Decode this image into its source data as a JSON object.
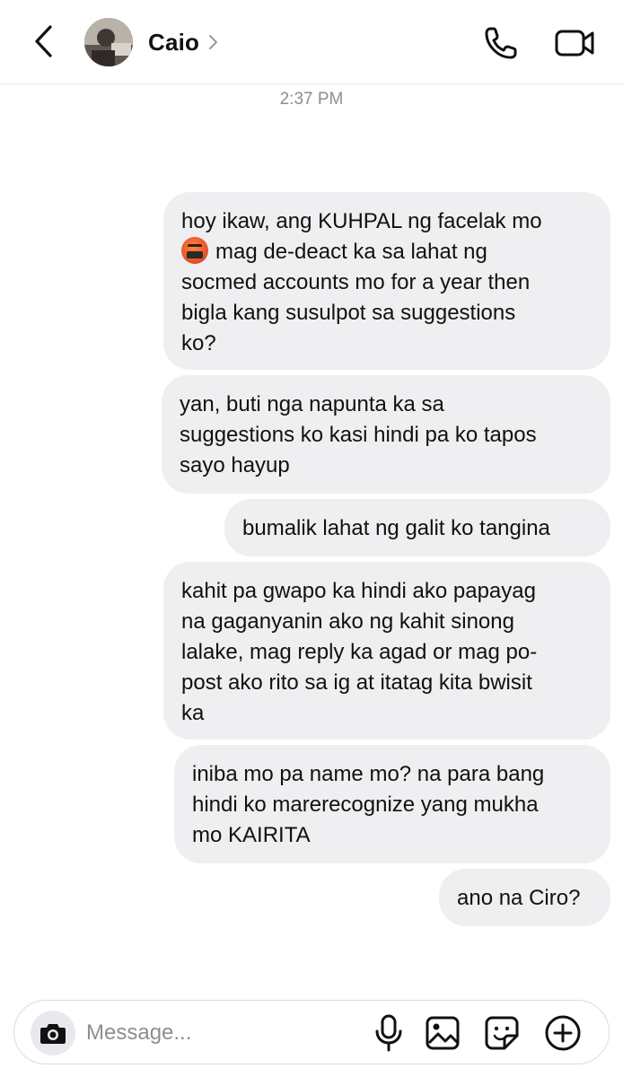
{
  "header": {
    "contact_name": "Caio",
    "avatar_icon": "avatar-photo",
    "back_icon": "chevron-left-icon",
    "profile_chevron_icon": "chevron-right-icon",
    "call_icon": "phone-icon",
    "video_icon": "video-camera-icon"
  },
  "thread": {
    "timestamp": "2:37 PM",
    "messages": [
      {
        "lines": [
          "hoy ikaw, ang KUHPAL ng facelak mo",
          "mag de-deact ka sa lahat ng",
          "socmed accounts mo for a year then",
          "bigla kang susulpot sa suggestions",
          "ko?"
        ],
        "emoji": "face-with-symbols-on-mouth"
      },
      {
        "lines": [
          "yan, buti nga napunta ka sa",
          "suggestions ko kasi hindi pa ko tapos",
          "sayo hayup"
        ]
      },
      {
        "lines": [
          "bumalik lahat ng galit ko tangina"
        ]
      },
      {
        "lines": [
          "kahit pa gwapo ka hindi ako papayag",
          "na gaganyanin ako ng kahit sinong",
          "lalake, mag reply ka agad or mag po-",
          "post ako rito sa ig at itatag kita bwisit",
          "ka"
        ]
      },
      {
        "lines": [
          "iniba mo pa name mo? na para bang",
          "hindi ko marerecognize yang mukha",
          "mo KAIRITA"
        ]
      },
      {
        "lines": [
          "ano na Ciro?"
        ]
      }
    ]
  },
  "composer": {
    "placeholder": "Message...",
    "camera_icon": "camera-icon",
    "mic_icon": "microphone-icon",
    "gallery_icon": "image-gallery-icon",
    "sticker_icon": "sticker-icon",
    "add_icon": "plus-circle-icon"
  },
  "colors": {
    "bubble": "#efeef1",
    "text": "#111111",
    "muted": "#8e8e8e",
    "divider": "#e9e9e9"
  }
}
